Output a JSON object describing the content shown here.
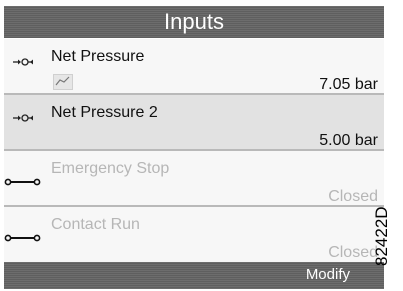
{
  "header": {
    "title": "Inputs"
  },
  "inputs": [
    {
      "name": "Net Pressure",
      "value": "7.05 bar",
      "icon": "pressure-sensor-icon",
      "trend_icon": "trend-graph-icon"
    },
    {
      "name": "Net Pressure 2",
      "value": "5.00 bar",
      "icon": "pressure-sensor-icon"
    },
    {
      "name": "Emergency Stop",
      "value": "Closed",
      "icon": "contact-icon"
    },
    {
      "name": "Contact Run",
      "value": "Closed",
      "icon": "contact-icon"
    }
  ],
  "footer": {
    "modify_label": "Modify"
  },
  "figure_id": "82422D",
  "colors": {
    "titlebar": "#666666",
    "selected_row": "#e2e2e2",
    "row": "#f7f7f7",
    "disabled_text": "#b6b6b6"
  }
}
